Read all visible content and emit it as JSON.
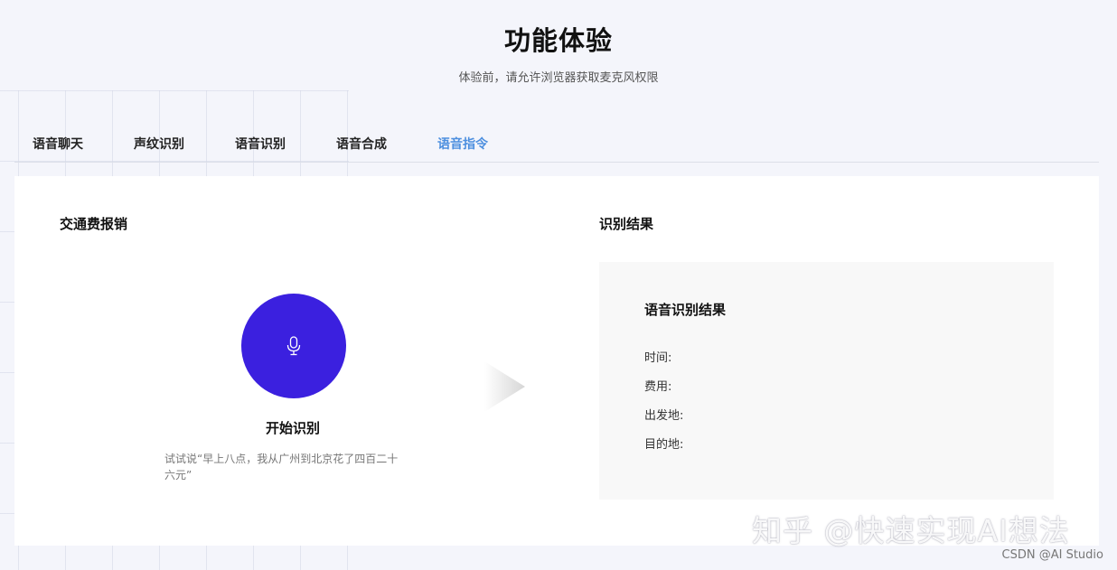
{
  "hero": {
    "title": "功能体验",
    "subtitle": "体验前，请允许浏览器获取麦克风权限"
  },
  "tabs": [
    {
      "label": "语音聊天",
      "active": false
    },
    {
      "label": "声纹识别",
      "active": false
    },
    {
      "label": "语音识别",
      "active": false
    },
    {
      "label": "语音合成",
      "active": false
    },
    {
      "label": "语音指令",
      "active": true
    }
  ],
  "left": {
    "title": "交通费报销",
    "mic_icon": "microphone-icon",
    "start_label": "开始识别",
    "hint": "试试说“早上八点，我从广州到北京花了四百二十六元”"
  },
  "right": {
    "title": "识别结果",
    "panel_heading": "语音识别结果",
    "fields": [
      {
        "label": "时间:",
        "value": ""
      },
      {
        "label": "费用:",
        "value": ""
      },
      {
        "label": "出发地:",
        "value": ""
      },
      {
        "label": "目的地:",
        "value": ""
      }
    ]
  },
  "watermark": "知乎 @快速实现AI想法",
  "credit": "CSDN @AI Studio",
  "colors": {
    "accent_tab": "#4d8fdf",
    "mic_button": "#3b20df",
    "background": "#f4f5fb"
  }
}
